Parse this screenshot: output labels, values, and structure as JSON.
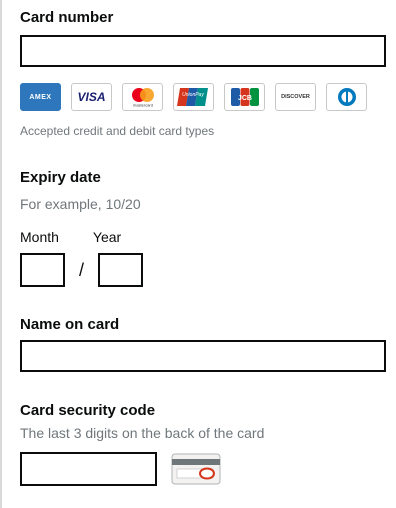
{
  "card_number": {
    "label": "Card number",
    "value": "",
    "accepted_cards_hint": "Accepted credit and debit card types",
    "logos": [
      {
        "name": "amex-logo",
        "text": "AMEX"
      },
      {
        "name": "visa-logo",
        "text": "VISA"
      },
      {
        "name": "mastercard-logo",
        "text": "mastercard"
      },
      {
        "name": "unionpay-logo",
        "text": "UnionPay"
      },
      {
        "name": "jcb-logo",
        "text": "JCB"
      },
      {
        "name": "discover-logo",
        "text": "DISCOVER"
      },
      {
        "name": "diners-club-logo",
        "text": ""
      }
    ]
  },
  "expiry": {
    "label": "Expiry date",
    "hint": "For example, 10/20",
    "month_label": "Month",
    "year_label": "Year",
    "separator": "/",
    "month_value": "",
    "year_value": ""
  },
  "name_on_card": {
    "label": "Name on card",
    "value": ""
  },
  "security_code": {
    "label": "Card security code",
    "hint": "The last 3 digits on the back of the card",
    "value": ""
  },
  "colors": {
    "text": "#0b0c0c",
    "hint": "#6f777b",
    "border": "#0b0c0c",
    "amex": "#2e77bc",
    "visa": "#1a1f71",
    "mc_red": "#eb001b",
    "mc_yellow": "#f79e1b",
    "cvc_circle": "#d4351c"
  }
}
